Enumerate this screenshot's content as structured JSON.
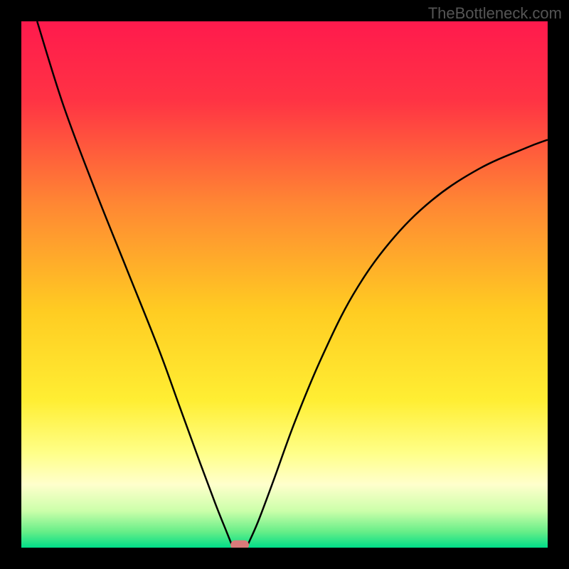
{
  "watermark": "TheBottleneck.com",
  "chart_data": {
    "type": "line",
    "title": "",
    "xlabel": "",
    "ylabel": "",
    "xlim": [
      0,
      100
    ],
    "ylim": [
      0,
      100
    ],
    "background_gradient": {
      "stops": [
        {
          "offset": 0,
          "color": "#ff1a4d"
        },
        {
          "offset": 0.15,
          "color": "#ff3344"
        },
        {
          "offset": 0.35,
          "color": "#ff8833"
        },
        {
          "offset": 0.55,
          "color": "#ffcc22"
        },
        {
          "offset": 0.72,
          "color": "#ffee33"
        },
        {
          "offset": 0.82,
          "color": "#ffff88"
        },
        {
          "offset": 0.88,
          "color": "#ffffcc"
        },
        {
          "offset": 0.93,
          "color": "#ccffaa"
        },
        {
          "offset": 0.97,
          "color": "#66ee88"
        },
        {
          "offset": 1,
          "color": "#00dd88"
        }
      ]
    },
    "series": [
      {
        "name": "left-branch",
        "type": "curve",
        "points": [
          {
            "x": 3,
            "y": 100
          },
          {
            "x": 8,
            "y": 84
          },
          {
            "x": 14,
            "y": 68
          },
          {
            "x": 20,
            "y": 53
          },
          {
            "x": 26,
            "y": 38
          },
          {
            "x": 30,
            "y": 27
          },
          {
            "x": 34,
            "y": 16
          },
          {
            "x": 37,
            "y": 8
          },
          {
            "x": 39,
            "y": 3
          },
          {
            "x": 40,
            "y": 0.5
          }
        ]
      },
      {
        "name": "right-branch",
        "type": "curve",
        "points": [
          {
            "x": 43,
            "y": 0.5
          },
          {
            "x": 45,
            "y": 5
          },
          {
            "x": 48,
            "y": 13
          },
          {
            "x": 52,
            "y": 24
          },
          {
            "x": 57,
            "y": 36
          },
          {
            "x": 63,
            "y": 48
          },
          {
            "x": 70,
            "y": 58
          },
          {
            "x": 78,
            "y": 66
          },
          {
            "x": 87,
            "y": 72
          },
          {
            "x": 96,
            "y": 76
          },
          {
            "x": 100,
            "y": 77.5
          }
        ]
      }
    ],
    "marker": {
      "x": 41.5,
      "y": 0.5,
      "width": 3.5,
      "height": 1.8,
      "color": "#d97a7a"
    }
  }
}
